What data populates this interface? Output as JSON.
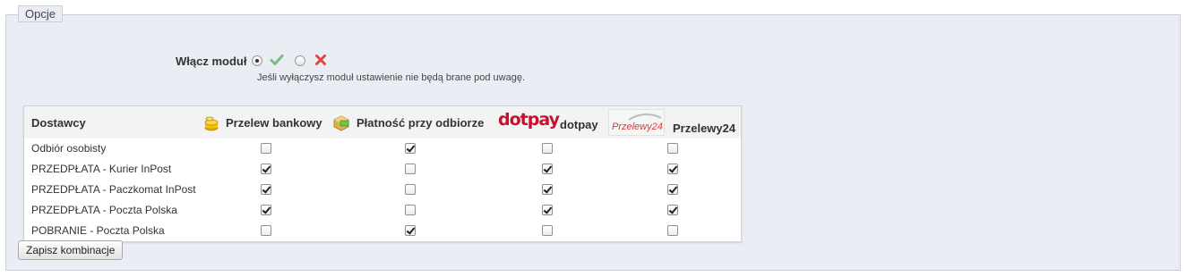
{
  "fieldset": {
    "legend": "Opcje"
  },
  "module": {
    "label": "Włącz moduł",
    "enabled": true,
    "hint": "Jeśli wyłączysz moduł ustawienie nie będą brane pod uwagę."
  },
  "table": {
    "header_carriers": "Dostawcy",
    "payments": [
      {
        "label": "Przelew bankowy",
        "icon": "coins-icon"
      },
      {
        "label": "Płatność przy odbiorze",
        "icon": "cash-on-delivery-icon"
      },
      {
        "label": "dotpay",
        "icon": "dotpay-logo",
        "logo_text": "dotpay"
      },
      {
        "label": "Przelewy24",
        "icon": "przelewy24-logo",
        "logo_text": "Przelewy24"
      }
    ],
    "rows": [
      {
        "name": "Odbiór osobisty",
        "checks": [
          false,
          true,
          false,
          false
        ]
      },
      {
        "name": "PRZEDPŁATA - Kurier InPost",
        "checks": [
          true,
          false,
          true,
          true
        ]
      },
      {
        "name": "PRZEDPŁATA - Paczkomat InPost",
        "checks": [
          true,
          false,
          true,
          true
        ]
      },
      {
        "name": "PRZEDPŁATA - Poczta Polska",
        "checks": [
          true,
          false,
          true,
          true
        ]
      },
      {
        "name": "POBRANIE - Poczta Polska",
        "checks": [
          false,
          true,
          false,
          false
        ]
      }
    ]
  },
  "actions": {
    "save_label": "Zapisz kombinacje"
  },
  "colors": {
    "yes_green": "#72c279",
    "no_red": "#e0463b",
    "panel_bg": "#ebedf4",
    "dotpay_red": "#c8102e"
  }
}
